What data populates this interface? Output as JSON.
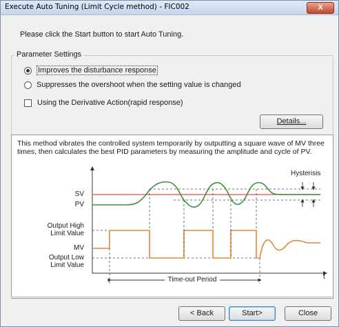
{
  "window": {
    "title": "Execute Auto Tuning (Limit Cycle method) - FIC002",
    "close_label": "X"
  },
  "instruction": "Please click the Start button to start Auto Tuning.",
  "parameter_settings": {
    "legend": "Parameter Settings",
    "options": [
      {
        "label": "Improves the disturbance response",
        "selected": true
      },
      {
        "label": "Suppresses the overshoot when the setting value is changed",
        "selected": false
      }
    ],
    "derivative": {
      "label": "Using the Derivative Action(rapid response)",
      "checked": false
    },
    "details_label": "Details..."
  },
  "diagram": {
    "description": "This method vibrates the controlled system temporarily by outputting a square wave of MV three times, then calculates the best PID parameters by measuring the amplitude and cycle of PV.",
    "labels": {
      "sv": "SV",
      "pv": "PV",
      "output_high": "Output High\nLimit Value",
      "mv": "MV",
      "output_low": "Output Low\nLimit Value",
      "hysteresis": "Hysterisis",
      "timeout": "Time-out Period",
      "t": "t"
    },
    "colors": {
      "sv": "#e4504e",
      "pv": "#3f8f3a",
      "mv": "#e08a2e",
      "axis": "#333333"
    }
  },
  "footer": {
    "back_label": "< Back",
    "start_label": "Start>",
    "close_label": "Close"
  }
}
